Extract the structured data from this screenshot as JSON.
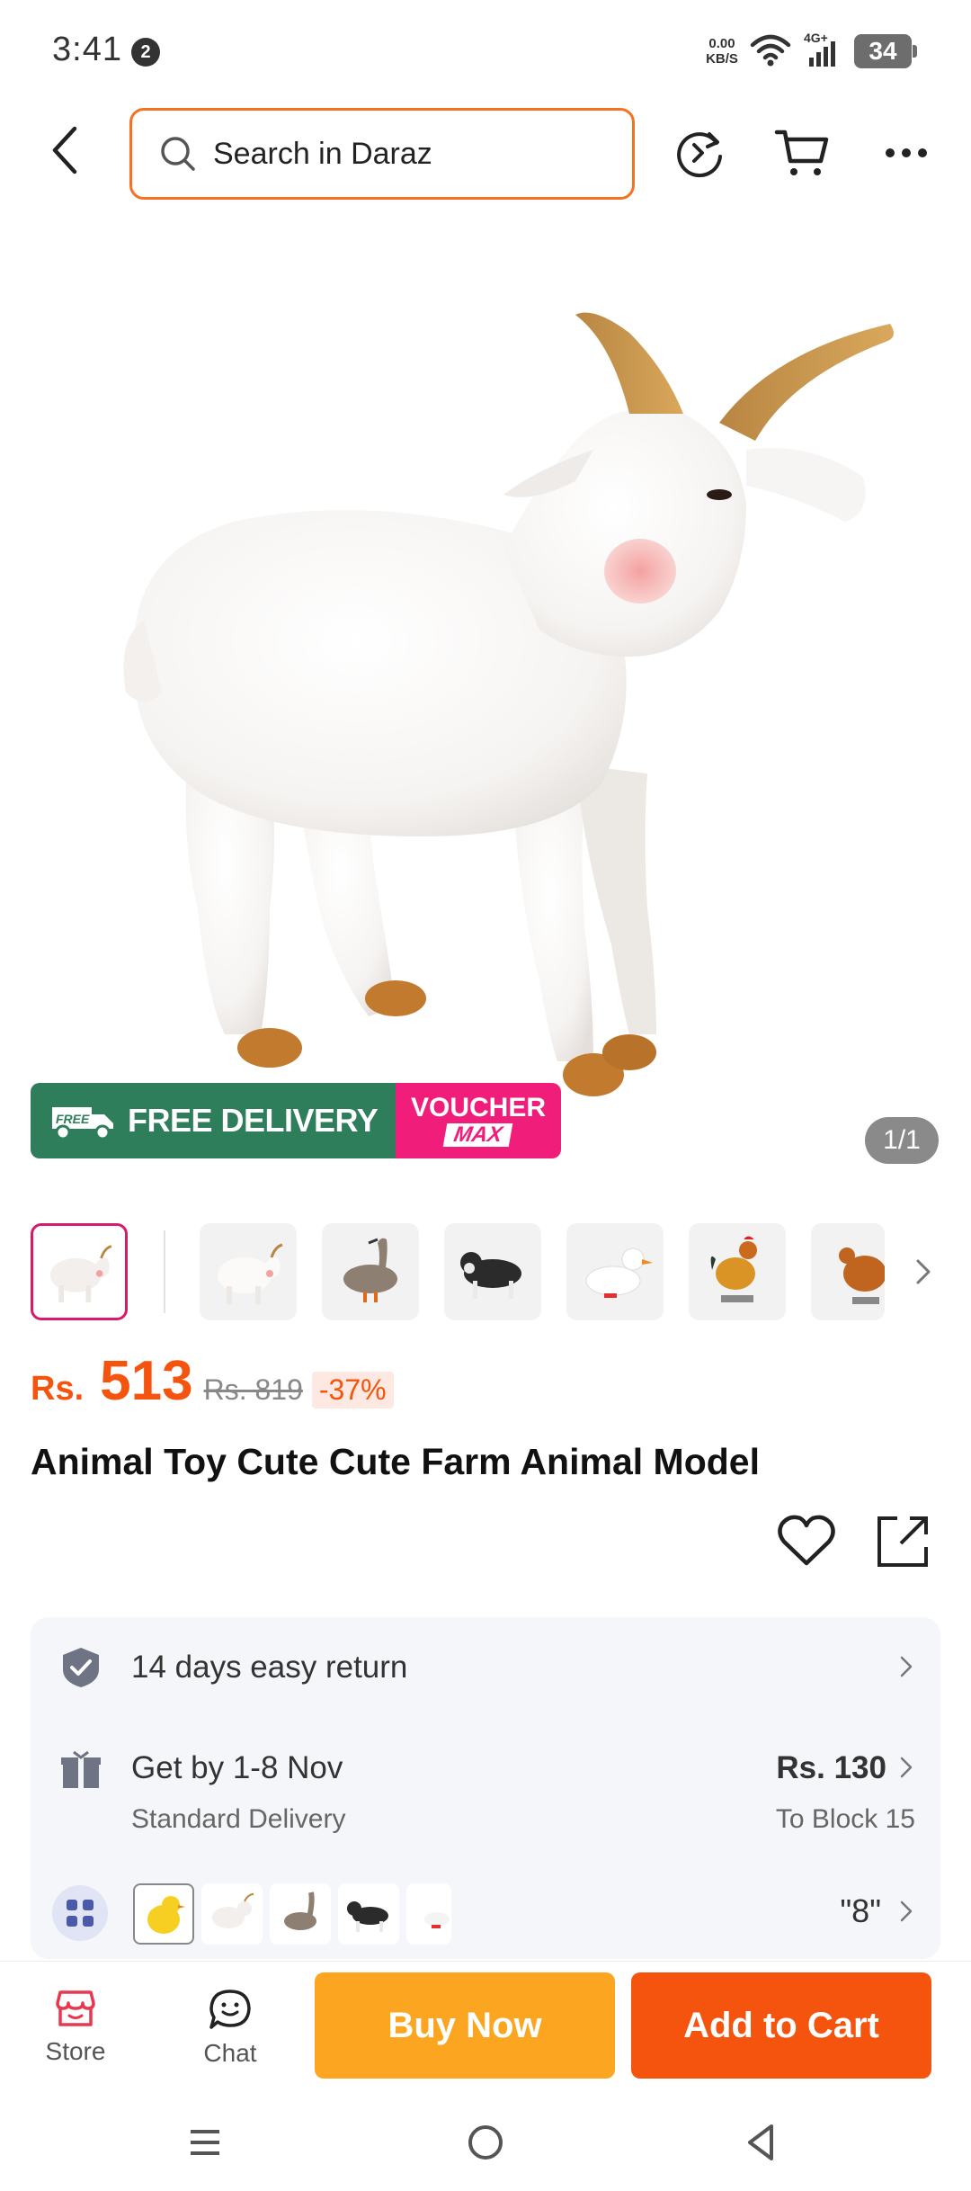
{
  "status_bar": {
    "time": "3:41",
    "notification_count": "2",
    "net_speed_value": "0.00",
    "net_speed_unit": "KB/S",
    "network_type": "4G+",
    "battery": "34"
  },
  "header": {
    "search_placeholder": "Search in Daraz"
  },
  "gallery": {
    "promo_label": "FREE DELIVERY",
    "promo_truck_label": "FREE",
    "voucher_top": "VOUCHER",
    "voucher_bottom": "MAX",
    "counter": "1/1",
    "thumbnails": [
      "goat",
      "goat",
      "goose",
      "dog",
      "duck",
      "rooster",
      "hen"
    ]
  },
  "product": {
    "currency": "Rs.",
    "price": "513",
    "original_price": "Rs. 819",
    "discount": "-37%",
    "title": "Animal Toy Cute Cute Farm Animal Model"
  },
  "info": {
    "returns": "14 days easy return",
    "delivery_title": "Get by 1-8 Nov",
    "delivery_sub": "Standard Delivery",
    "delivery_fee": "Rs. 130",
    "delivery_location": "To Block 15",
    "variant_count": "\"8\""
  },
  "bottom_bar": {
    "store_label": "Store",
    "chat_label": "Chat",
    "buy_now": "Buy Now",
    "add_to_cart": "Add to Cart"
  },
  "colors": {
    "brand_orange": "#f5540e",
    "buy_now": "#fca521",
    "promo_green": "#2e7d5b",
    "voucher_pink": "#f01e7a"
  }
}
